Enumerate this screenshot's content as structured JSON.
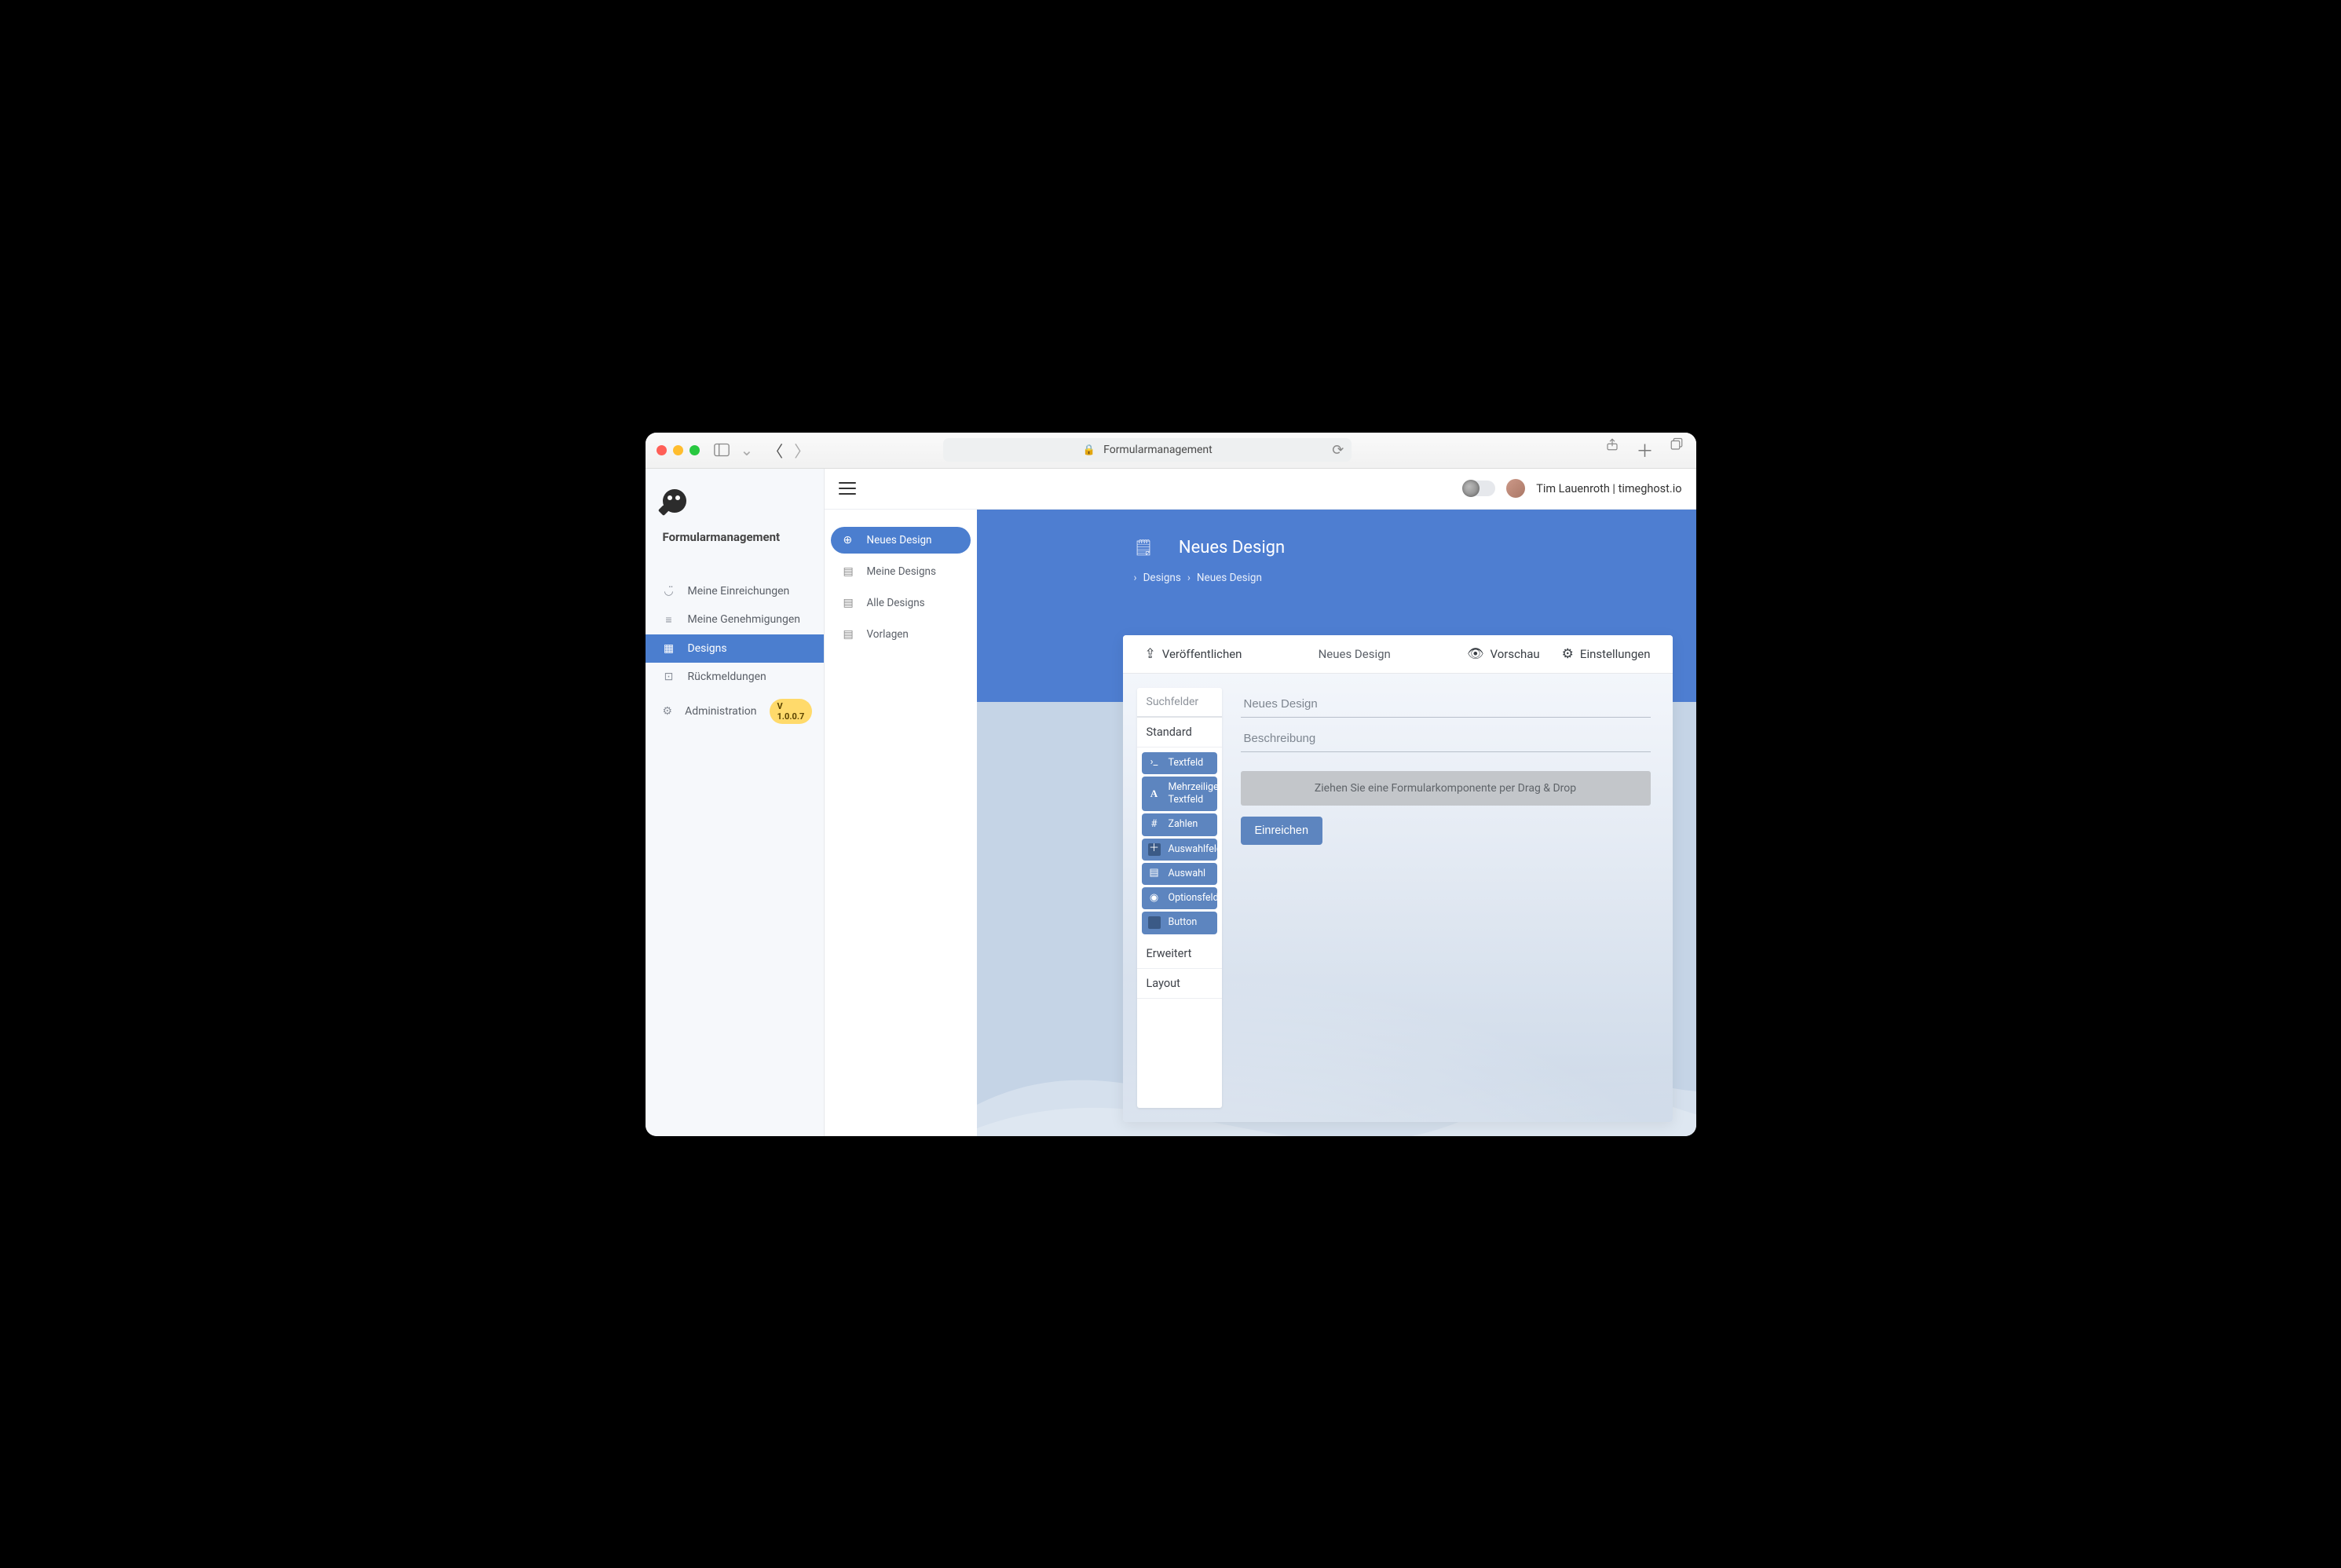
{
  "browser": {
    "title": "Formularmanagement"
  },
  "sidebar": {
    "title": "Formularmanagement",
    "items": [
      {
        "icon": "user-icon",
        "label": "Meine Einreichungen"
      },
      {
        "icon": "approvals-icon",
        "label": "Meine Genehmigungen"
      },
      {
        "icon": "designs-icon",
        "label": "Designs",
        "active": true
      },
      {
        "icon": "feedback-icon",
        "label": "Rückmeldungen"
      },
      {
        "icon": "gear-icon",
        "label": "Administration",
        "badge": "V 1.0.0.7",
        "caret": true
      }
    ]
  },
  "subnav": {
    "items": [
      {
        "icon": "plus-circle-icon",
        "label": "Neues Design",
        "active": true
      },
      {
        "icon": "list-icon",
        "label": "Meine Designs"
      },
      {
        "icon": "list-icon",
        "label": "Alle Designs"
      },
      {
        "icon": "list-icon",
        "label": "Vorlagen"
      }
    ]
  },
  "topbar": {
    "user": "Tim Lauenroth | timeghost.io"
  },
  "page": {
    "title": "Neues Design",
    "breadcrumb": [
      "Designs",
      "Neues Design"
    ]
  },
  "editor": {
    "toolbar": {
      "publish": "Veröffentlichen",
      "center": "Neues Design",
      "preview": "Vorschau",
      "settings": "Einstellungen"
    },
    "palette": {
      "search_placeholder": "Suchfelder",
      "sections": {
        "standard": "Standard",
        "advanced": "Erweitert",
        "layout": "Layout"
      },
      "standard_items": [
        {
          "icon": "terminal-icon",
          "label": "Textfeld"
        },
        {
          "icon": "font-icon",
          "label": "Mehrzeiliges Textfeld"
        },
        {
          "icon": "hash-icon",
          "label": "Zahlen"
        },
        {
          "icon": "plus-square-icon",
          "label": "Auswahlfelder"
        },
        {
          "icon": "list-icon",
          "label": "Auswahl"
        },
        {
          "icon": "radio-icon",
          "label": "Optionsfeld"
        },
        {
          "icon": "square-icon",
          "label": "Button"
        }
      ]
    },
    "canvas": {
      "name_placeholder": "Neues Design",
      "description_placeholder": "Beschreibung",
      "dropzone": "Ziehen Sie eine Formularkomponente per Drag & Drop",
      "submit": "Einreichen"
    }
  }
}
